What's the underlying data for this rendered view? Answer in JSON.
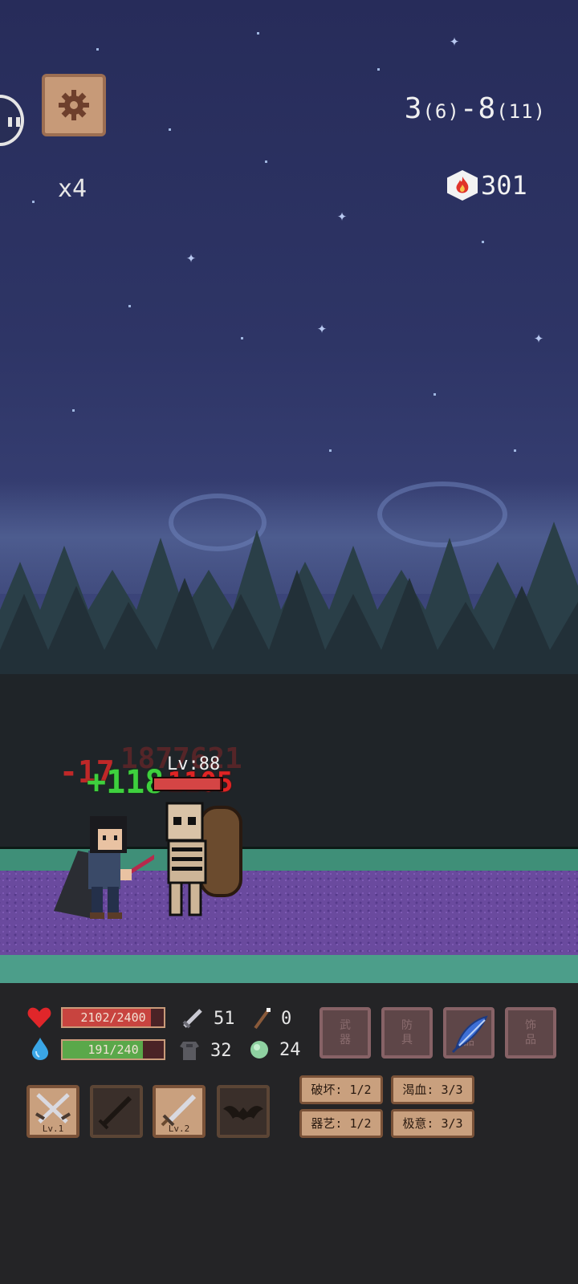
{
  "hud": {
    "speed": "x4",
    "stage_main_a": "3",
    "stage_sub_a": "(6)",
    "stage_main_b": "-8",
    "stage_sub_b": "(11)",
    "currency": "301"
  },
  "battle": {
    "enemy_level": "Lv:88",
    "enemy_hp_fraction": 0.98,
    "floating_damage_1": "-17",
    "floating_heal": "+118",
    "floating_damage_2": "-1105",
    "floating_faded": "1877621"
  },
  "player": {
    "hp_text": "2102/2400",
    "hp_fraction": 0.876,
    "mp_text": "191/240",
    "mp_fraction": 0.796,
    "attack": "51",
    "magic": "0",
    "defense": "32",
    "resist": "24"
  },
  "equipment_slots": [
    {
      "line1": "武",
      "line2": "器",
      "icon": "empty-slot"
    },
    {
      "line1": "防",
      "line2": "具",
      "icon": "empty-slot"
    },
    {
      "line1": "",
      "line2": "品",
      "icon": "blue-feather-icon"
    },
    {
      "line1": "饰",
      "line2": "品",
      "icon": "empty-slot"
    }
  ],
  "skills": [
    {
      "name": "crossed-swords-icon",
      "level": "Lv.1",
      "locked": false
    },
    {
      "name": "dagger-icon",
      "level": "",
      "locked": true
    },
    {
      "name": "sword-icon",
      "level": "Lv.2",
      "locked": false
    },
    {
      "name": "bat-icon",
      "level": "",
      "locked": true
    }
  ],
  "traits": [
    {
      "label": "破坏: 1/2"
    },
    {
      "label": "渴血: 3/3"
    },
    {
      "label": "器艺: 1/2"
    },
    {
      "label": "极意: 3/3"
    }
  ],
  "colors": {
    "hp_fill": "#c8443f",
    "mp_fill": "#5aa84a",
    "panel_bg": "#242426",
    "sky_top": "#272c5a",
    "ground_purple": "#6a4a9e",
    "ground_green": "#3f8f78"
  }
}
